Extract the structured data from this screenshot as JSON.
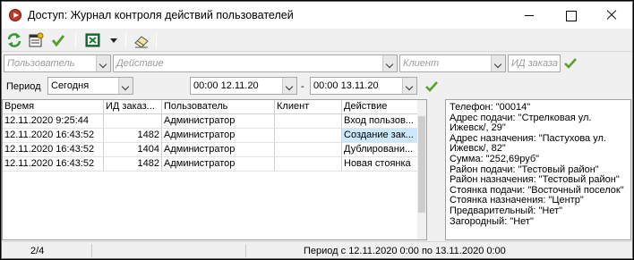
{
  "window": {
    "title": "Доступ: Журнал контроля действий пользователей"
  },
  "toolbar": {
    "icons": [
      "refresh-icon",
      "properties-icon",
      "apply-icon",
      "excel-icon",
      "dropdown-icon",
      "erase-icon"
    ]
  },
  "filters": {
    "user_placeholder": "Пользователь",
    "action_placeholder": "Действие",
    "client_placeholder": "Клиент",
    "order_id_placeholder": "ИД заказа"
  },
  "period": {
    "label": "Период",
    "preset": "Сегодня",
    "from": "00:00 12.11.20",
    "dash": "-",
    "to": "00:00 13.11.20"
  },
  "table": {
    "columns": [
      "Время",
      "ИД заказ...",
      "Пользователь",
      "Клиент",
      "Действие"
    ],
    "rows": [
      {
        "time": "12.11.2020 9:25:44",
        "order_id": "",
        "user": "Администратор",
        "client": "",
        "action": "Вход пользов..."
      },
      {
        "time": "12.11.2020 16:43:52",
        "order_id": "1482",
        "user": "Администратор",
        "client": "",
        "action": "Создание зак..."
      },
      {
        "time": "12.11.2020 16:43:52",
        "order_id": "1404",
        "user": "Администратор",
        "client": "",
        "action": "Дублировани..."
      },
      {
        "time": "12.11.2020 16:43:52",
        "order_id": "1482",
        "user": "Администратор",
        "client": "",
        "action": "Новая стоянка"
      }
    ]
  },
  "details": {
    "lines": [
      "Телефон: \"00014\"",
      "Адрес подачи: \"Стрелковая ул.",
      "Ижевск/, 29\"",
      "Адрес назначения: \"Пастухова ул.",
      "Ижевск/, 82\"",
      "Сумма: \"252,69руб\"",
      "Район подачи: \"Тестовый район\"",
      "Район назначения: \"Тестовый район\"",
      "Стоянка подачи: \"Восточный поселок\"",
      "Стоянка назначения: \"Центр\"",
      "Предварительный: \"Нет\"",
      "Загородный: \"Нет\""
    ]
  },
  "status": {
    "count": "2/4",
    "period_text": "Период с 12.11.2020 0:00 по 13.11.2020 0:00"
  },
  "colors": {
    "selection": "#cce8ff",
    "check_green": "#5aa02c",
    "excel_green": "#1f7a3a"
  }
}
